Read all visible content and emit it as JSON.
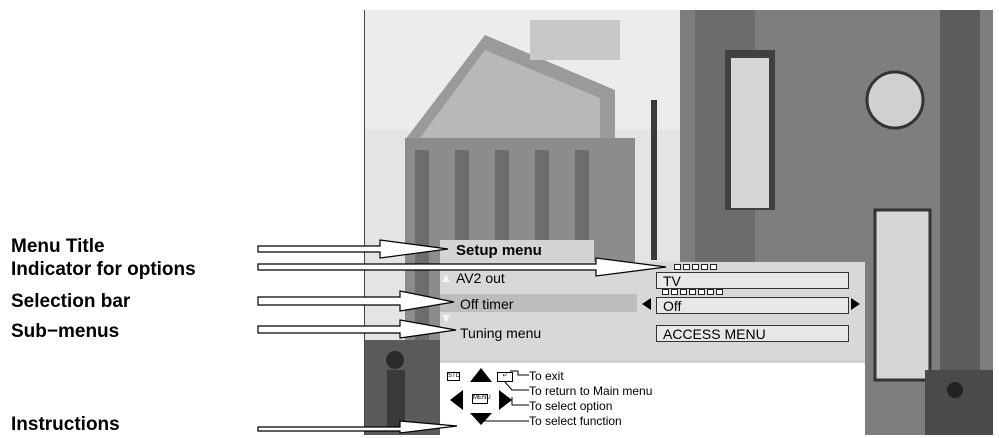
{
  "labels": {
    "menu_title": "Menu Title",
    "indicator": "Indicator for options",
    "selection_bar": "Selection bar",
    "sub_menus": "Sub−menus",
    "instructions": "Instructions"
  },
  "menu": {
    "title": "Setup menu",
    "rows": [
      {
        "label": "AV2 out",
        "value": "TV"
      },
      {
        "label": "Off timer",
        "value": "Off"
      },
      {
        "label": "Tuning menu",
        "value": "ACCESS MENU"
      }
    ]
  },
  "keys": {
    "std": "STD",
    "menu": "MENU",
    "back": "↵"
  },
  "instructions": {
    "exit": "To exit",
    "main_menu": "To return to Main menu",
    "select_option": "To select option",
    "select_function": "To select function"
  }
}
